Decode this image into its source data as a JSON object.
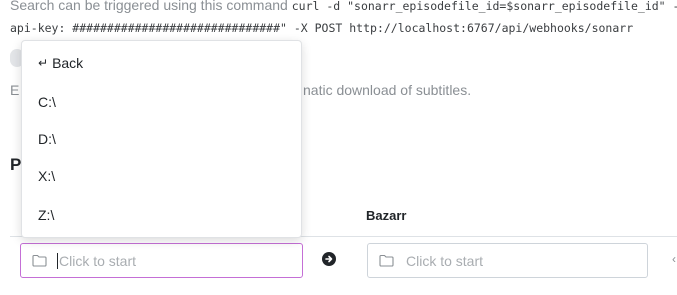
{
  "background": {
    "cmd_prefix": "Search can be triggered using this command",
    "cmd_code_1": "curl -d \"sonarr_episodefile_id=$sonarr_episodefile_id\" -H",
    "cmd_code_2": "api-key: ##############################\" -X POST http://localhost:6767/api/webhooks/sonarr",
    "desc_left": "E",
    "desc_right": "natic download of subtitles.",
    "section_heading": "P",
    "bazarr_header": "Bazarr",
    "edge_mark": "‹"
  },
  "inputs": {
    "left_placeholder": "Click to start",
    "right_placeholder": "Click to start"
  },
  "dropdown": {
    "back_icon": "↵",
    "back_label": "Back",
    "drives": [
      "C:\\",
      "D:\\",
      "X:\\",
      "Z:\\"
    ]
  },
  "colors": {
    "focus_border": "#c46fd6",
    "text_primary": "#212529",
    "text_muted": "#8a8f94"
  },
  "icons": {
    "folder": "folder-icon",
    "arrow": "arrow-right-circle-icon",
    "back": "back-arrow-icon"
  }
}
